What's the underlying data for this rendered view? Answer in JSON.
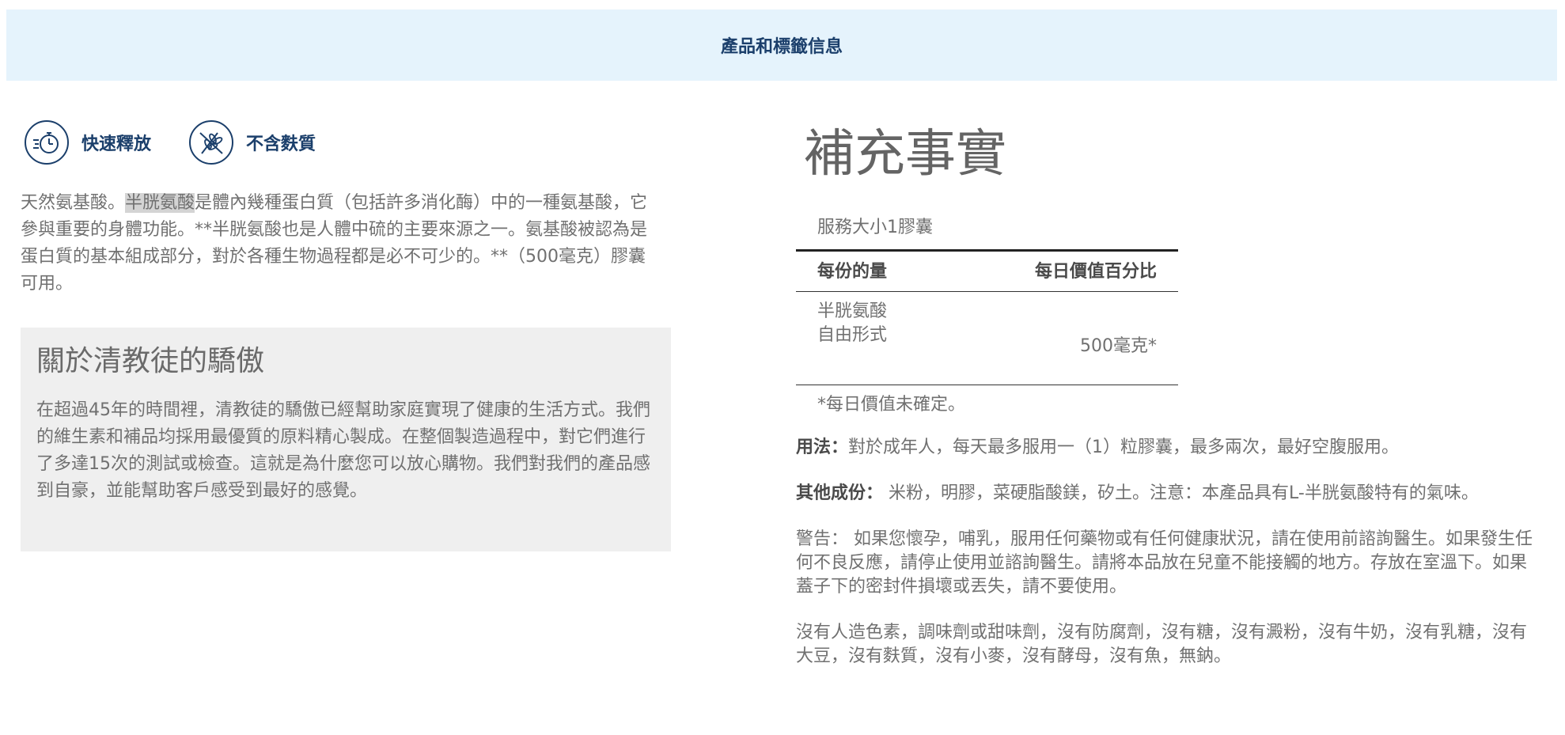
{
  "header": {
    "title": "產品和標籤信息"
  },
  "features": [
    {
      "icon": "fast-release-timer-icon",
      "label": "快速釋放"
    },
    {
      "icon": "wheat-gluten-free-icon",
      "label": "不含麩質"
    }
  ],
  "intro": {
    "before": "天然氨基酸。",
    "highlight": "半胱氨酸",
    "after": "是體內幾種蛋白質（包括許多消化酶）中的一種氨基酸，它參與重要的身體功能。**半胱氨酸也是人體中硫的主要來源之一。氨基酸被認為是蛋白質的基本組成部分，對於各種生物過程都是必不可少的。**（500毫克）膠囊可用。"
  },
  "about": {
    "title": "關於清教徒的驕傲",
    "body": "在超過45年的時間裡，清教徒的驕傲已經幫助家庭實現了健康的生活方式。我們的維生素和補品均採用最優質的原料精心製成。在整個製造過程中，對它們進行了多達15次的測試或檢查。這就是為什麼您可以放心購物。我們對我們的產品感到自豪，並能幫助客戶感受到最好的感覺。"
  },
  "facts": {
    "title": "補充事實",
    "serving": "服務大小1膠囊",
    "col_amount": "每份的量",
    "col_dv": "每日價值百分比",
    "rows": [
      {
        "name_line1": "半胱氨酸",
        "name_line2": "自由形式",
        "value": "500毫克*"
      }
    ],
    "footnote": "*每日價值未確定。"
  },
  "usage": {
    "label": "用法：",
    "text": "對於成年人，每天最多服用一（1）粒膠囊，最多兩次，最好空腹服用。"
  },
  "other_ingredients": {
    "label": "其他成份：",
    "text": " 米粉，明膠，菜硬脂酸鎂，矽土。注意：本產品具有L-半胱氨酸特有的氣味。"
  },
  "warning": {
    "text": "警告： 如果您懷孕，哺乳，服用任何藥物或有任何健康狀況，請在使用前諮詢醫生。如果發生任何不良反應，請停止使用並諮詢醫生。請將本品放在兒童不能接觸的地方。存放在室溫下。如果蓋子下的密封件損壞或丟失，請不要使用。"
  },
  "free_from": {
    "text": "沒有人造色素，調味劑或甜味劑，沒有防腐劑，沒有糖，沒有澱粉，沒有牛奶，沒有乳糖，沒有大豆，沒有麩質，沒有小麥，沒有酵母，沒有魚，無鈉。"
  },
  "colors": {
    "header_bg": "#e5f3fc",
    "brand_navy": "#1b3f6b",
    "about_bg": "#efefef",
    "highlight_bg": "#d4d4d4"
  }
}
